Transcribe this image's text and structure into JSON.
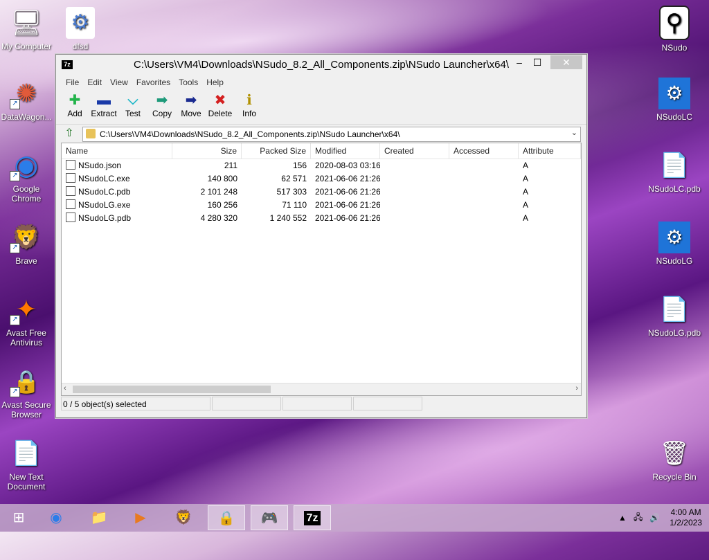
{
  "desktop": {
    "left_icons": [
      {
        "label": "My Computer",
        "glyph": "🖥"
      },
      {
        "label": "dfsd",
        "glyph": "⚙"
      },
      {
        "label": "DataWagon...",
        "glyph": "✺"
      },
      {
        "label": "Google\nChrome",
        "glyph": "◉"
      },
      {
        "label": "Brave",
        "glyph": "🦁"
      },
      {
        "label": "Avast Free\nAntivirus",
        "glyph": "✦"
      },
      {
        "label": "Avast Secure\nBrowser",
        "glyph": "🔒"
      },
      {
        "label": "New Text\nDocument",
        "glyph": "📄"
      }
    ],
    "right_icons": [
      {
        "label": "NSudo",
        "glyph": "⚲"
      },
      {
        "label": "NSudoLC",
        "glyph": "⚙"
      },
      {
        "label": "NSudoLC.pdb",
        "glyph": "📄"
      },
      {
        "label": "NSudoLG",
        "glyph": "⚙"
      },
      {
        "label": "NSudoLG.pdb",
        "glyph": "📄"
      },
      {
        "label": "Recycle Bin",
        "glyph": "🗑"
      }
    ]
  },
  "window": {
    "app_icon": "7z",
    "title": "C:\\Users\\VM4\\Downloads\\NSudo_8.2_All_Components.zip\\NSudo Launcher\\x64\\",
    "min": "‒",
    "max": "☐",
    "close": "✕",
    "menu": [
      "File",
      "Edit",
      "View",
      "Favorites",
      "Tools",
      "Help"
    ],
    "toolbar": [
      {
        "label": "Add",
        "glyph": "✚",
        "color": "#22b34a"
      },
      {
        "label": "Extract",
        "glyph": "▬",
        "color": "#1a3aa8"
      },
      {
        "label": "Test",
        "glyph": "⌵",
        "color": "#20b8c8"
      },
      {
        "label": "Copy",
        "glyph": "➡",
        "color": "#1e9a7a"
      },
      {
        "label": "Move",
        "glyph": "➡",
        "color": "#1a2a90"
      },
      {
        "label": "Delete",
        "glyph": "✖",
        "color": "#d42020"
      },
      {
        "label": "Info",
        "glyph": "ℹ",
        "color": "#b09000"
      }
    ],
    "address": "C:\\Users\\VM4\\Downloads\\NSudo_8.2_All_Components.zip\\NSudo Launcher\\x64\\",
    "columns": [
      "Name",
      "Size",
      "Packed Size",
      "Modified",
      "Created",
      "Accessed",
      "Attribute"
    ],
    "files": [
      {
        "name": "NSudo.json",
        "size": "211",
        "packed": "156",
        "modified": "2020-08-03 03:16",
        "created": "",
        "accessed": "",
        "attr": "A"
      },
      {
        "name": "NSudoLC.exe",
        "size": "140 800",
        "packed": "62 571",
        "modified": "2021-06-06 21:26",
        "created": "",
        "accessed": "",
        "attr": "A"
      },
      {
        "name": "NSudoLC.pdb",
        "size": "2 101 248",
        "packed": "517 303",
        "modified": "2021-06-06 21:26",
        "created": "",
        "accessed": "",
        "attr": "A"
      },
      {
        "name": "NSudoLG.exe",
        "size": "160 256",
        "packed": "71 110",
        "modified": "2021-06-06 21:26",
        "created": "",
        "accessed": "",
        "attr": "A"
      },
      {
        "name": "NSudoLG.pdb",
        "size": "4 280 320",
        "packed": "1 240 552",
        "modified": "2021-06-06 21:26",
        "created": "",
        "accessed": "",
        "attr": "A"
      }
    ],
    "status": "0 / 5 object(s) selected"
  },
  "taskbar": {
    "items": [
      {
        "name": "start",
        "glyph": "⊞"
      },
      {
        "name": "chrome",
        "glyph": "◉"
      },
      {
        "name": "explorer",
        "glyph": "📁"
      },
      {
        "name": "media",
        "glyph": "▶"
      },
      {
        "name": "brave",
        "glyph": "🦁"
      },
      {
        "name": "avast-browser",
        "glyph": "🔒"
      },
      {
        "name": "xbox",
        "glyph": "🎮"
      },
      {
        "name": "7zip",
        "glyph": "7z"
      }
    ],
    "time": "4:00 AM",
    "date": "1/2/2023"
  }
}
